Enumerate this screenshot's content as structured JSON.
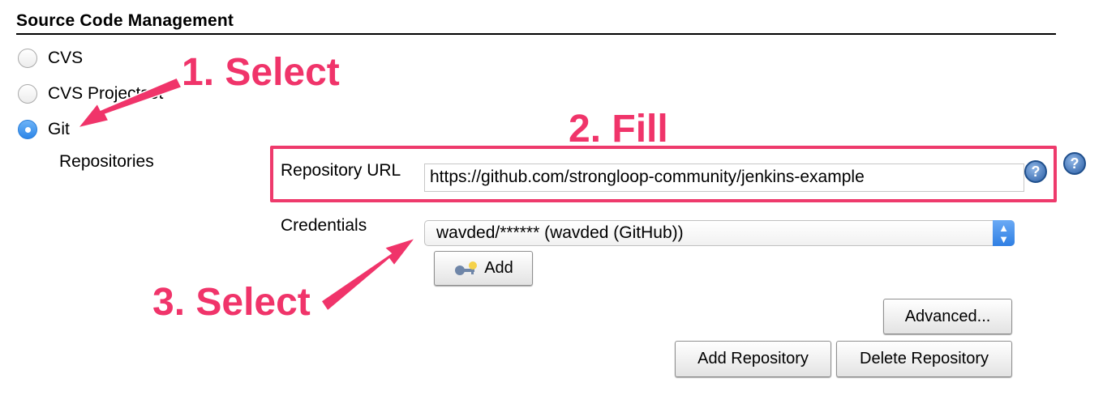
{
  "section": {
    "title": "Source Code Management"
  },
  "scm_options": [
    {
      "label": "CVS",
      "checked": false
    },
    {
      "label": "CVS Projectset",
      "checked": false
    },
    {
      "label": "Git",
      "checked": true
    }
  ],
  "repositories": {
    "label": "Repositories",
    "url_label": "Repository URL",
    "url_value": "https://github.com/strongloop-community/jenkins-example",
    "credentials_label": "Credentials",
    "credentials_value": "wavded/****** (wavded (GitHub))",
    "add_label": "Add",
    "advanced_label": "Advanced...",
    "add_repo_label": "Add Repository",
    "delete_repo_label": "Delete Repository",
    "help_text": "?"
  },
  "annotations": {
    "step1": "1. Select",
    "step2": "2. Fill",
    "step3": "3. Select"
  },
  "colors": {
    "annotation": "#f0346a",
    "radio_selected": "#2d86e8"
  },
  "icons": {
    "help": "help-icon",
    "key": "key-icon",
    "select_arrow": "chevron-updown-icon"
  }
}
